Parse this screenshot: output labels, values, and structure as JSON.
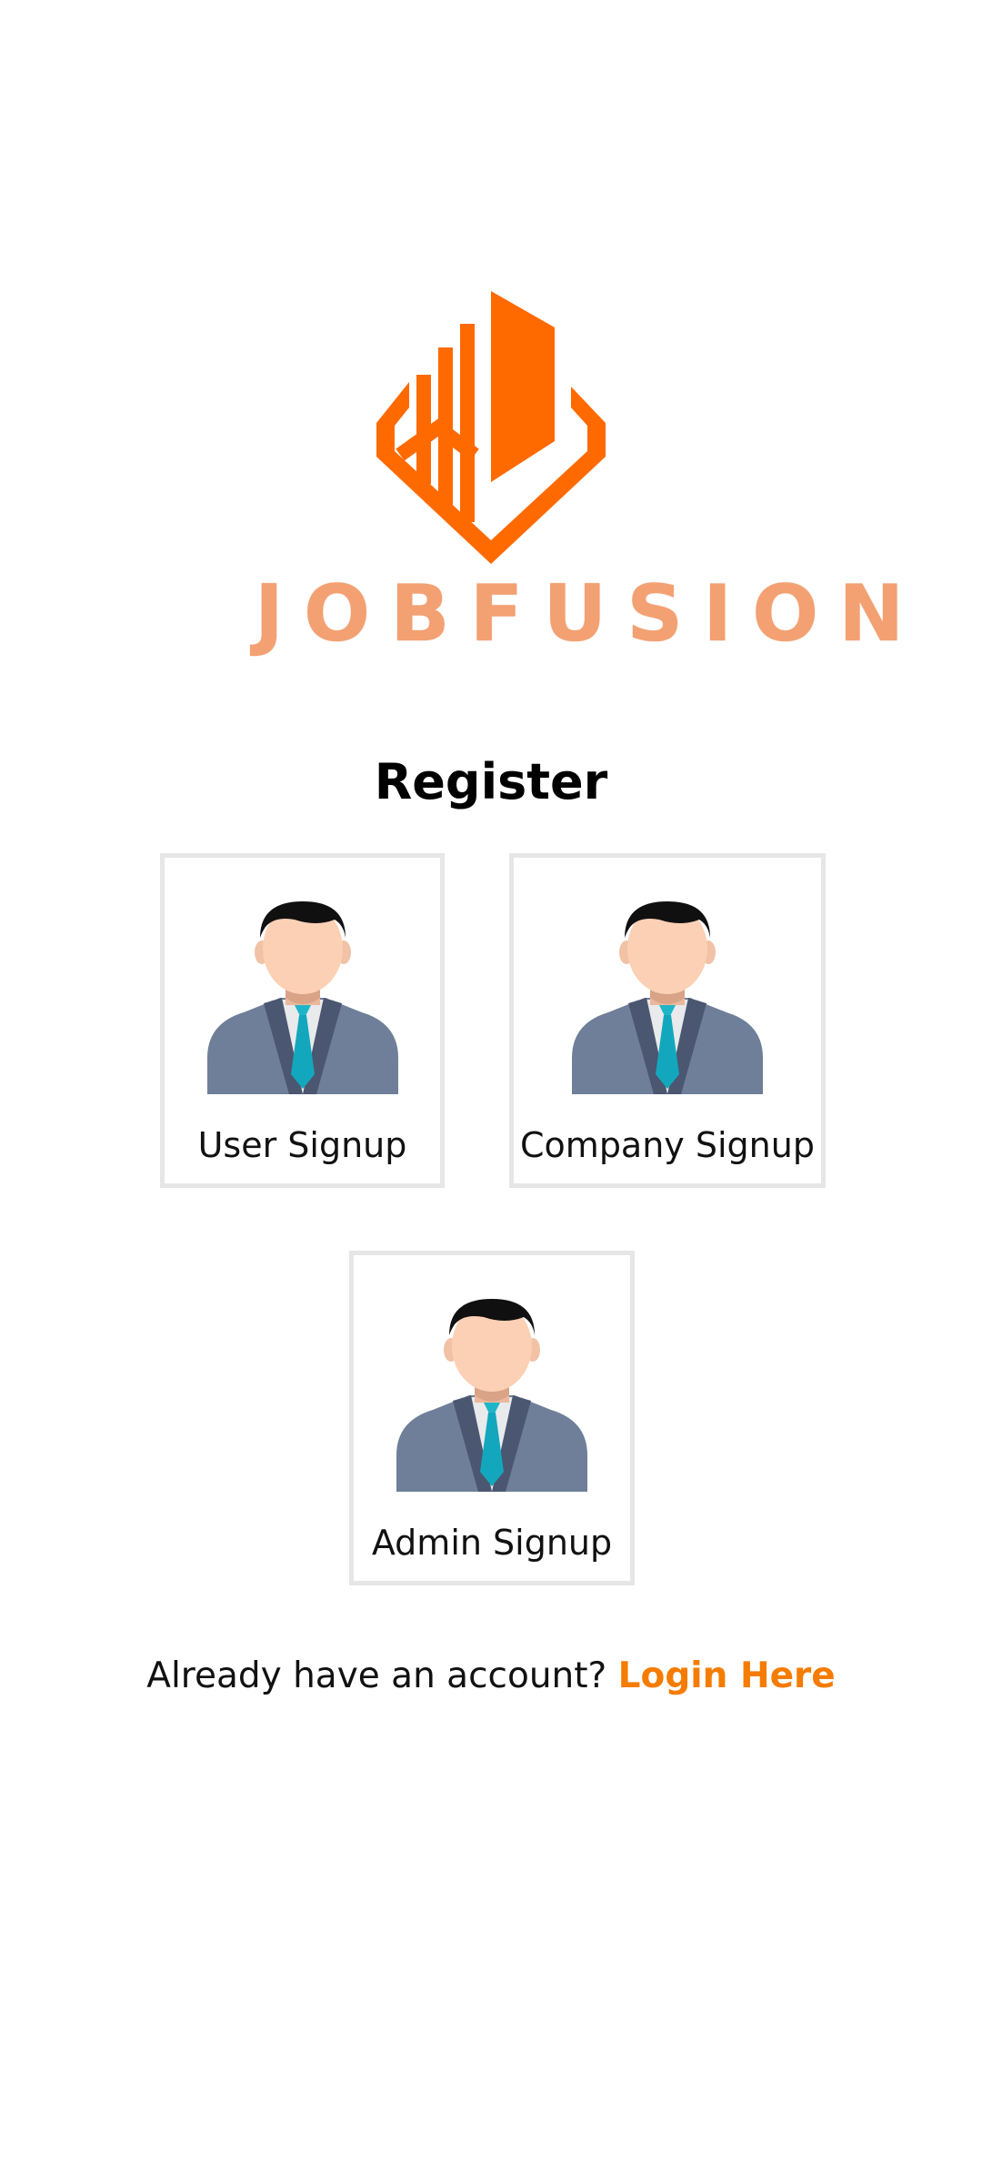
{
  "brand": {
    "name": "JOBFUSION",
    "color": "#ff6a00",
    "icon": "building-logo-icon"
  },
  "page": {
    "title": "Register"
  },
  "signup_options": [
    {
      "label": "User Signup",
      "icon": "user-avatar-icon"
    },
    {
      "label": "Company Signup",
      "icon": "company-avatar-icon"
    },
    {
      "label": "Admin Signup",
      "icon": "admin-avatar-icon"
    }
  ],
  "footer": {
    "prompt": "Already have an account?",
    "link_label": "Login Here",
    "link_color": "#f57c00"
  }
}
